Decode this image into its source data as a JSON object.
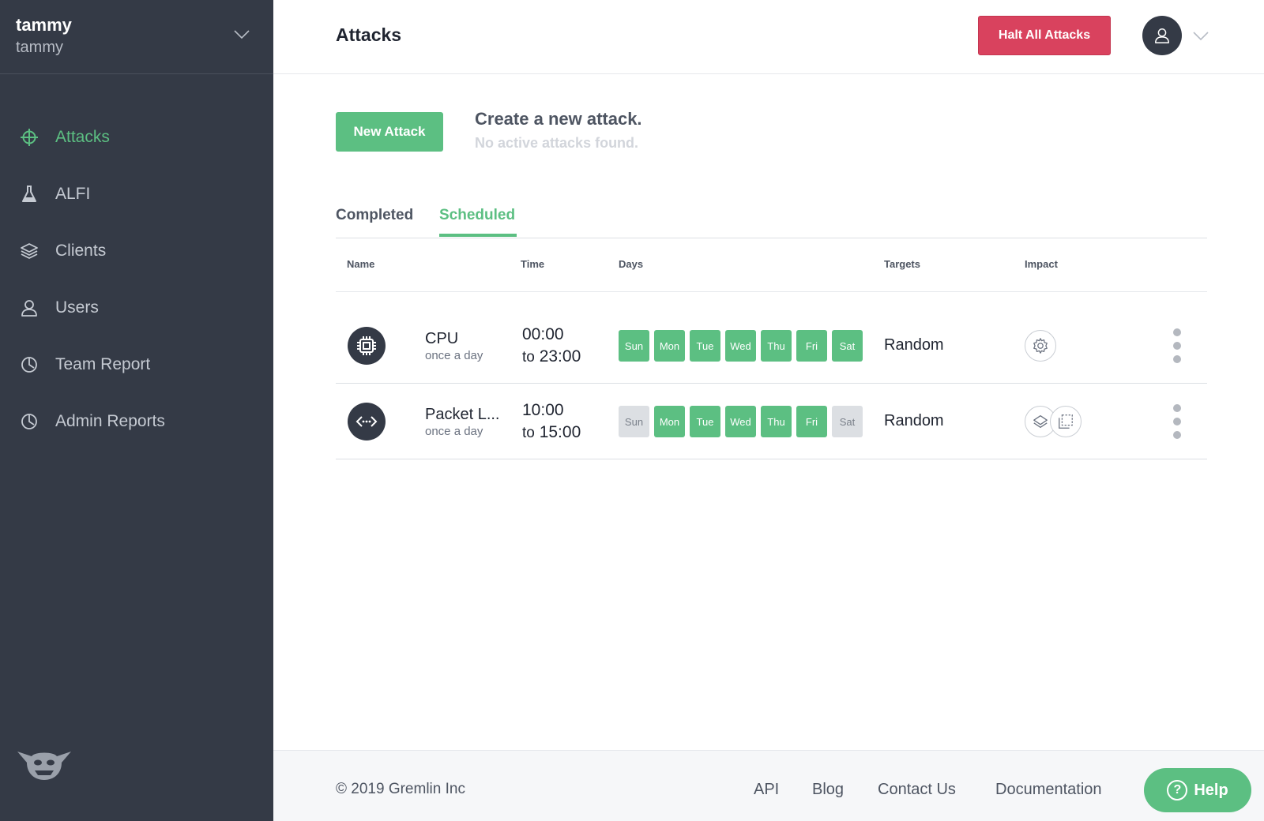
{
  "sidebar": {
    "user_name": "tammy",
    "org_name": "tammy",
    "items": [
      {
        "label": "Attacks",
        "icon": "crosshair-icon",
        "active": true
      },
      {
        "label": "ALFI",
        "icon": "flask-icon",
        "active": false
      },
      {
        "label": "Clients",
        "icon": "layers-icon",
        "active": false
      },
      {
        "label": "Users",
        "icon": "users-icon",
        "active": false
      },
      {
        "label": "Team Report",
        "icon": "pie-chart-icon",
        "active": false
      },
      {
        "label": "Admin Reports",
        "icon": "pie-chart-icon",
        "active": false
      }
    ],
    "logo_icon": "gremlin-logo-icon"
  },
  "header": {
    "title": "Attacks",
    "halt_label": "Halt All Attacks"
  },
  "cta": {
    "button_label": "New Attack",
    "title": "Create a new attack.",
    "subtitle": "No active attacks found."
  },
  "tabs": [
    {
      "label": "Completed",
      "active": false
    },
    {
      "label": "Scheduled",
      "active": true
    }
  ],
  "table": {
    "headers": [
      "Name",
      "Time",
      "Days",
      "Targets",
      "Impact"
    ],
    "rows": [
      {
        "name": "CPU",
        "frequency": "once a day",
        "time_from": "00:00",
        "to_word": "to",
        "time_to": "23:00",
        "days": [
          {
            "label": "Sun",
            "on": true
          },
          {
            "label": "Mon",
            "on": true
          },
          {
            "label": "Tue",
            "on": true
          },
          {
            "label": "Wed",
            "on": true
          },
          {
            "label": "Thu",
            "on": true
          },
          {
            "label": "Fri",
            "on": true
          },
          {
            "label": "Sat",
            "on": true
          }
        ],
        "target": "Random",
        "icon": "cpu-chip-icon",
        "impact_icons": [
          "gear-icon"
        ]
      },
      {
        "name": "Packet L...",
        "frequency": "once a day",
        "time_from": "10:00",
        "to_word": "to",
        "time_to": "15:00",
        "days": [
          {
            "label": "Sun",
            "on": false
          },
          {
            "label": "Mon",
            "on": true
          },
          {
            "label": "Tue",
            "on": true
          },
          {
            "label": "Wed",
            "on": true
          },
          {
            "label": "Thu",
            "on": true
          },
          {
            "label": "Fri",
            "on": true
          },
          {
            "label": "Sat",
            "on": false
          }
        ],
        "target": "Random",
        "icon": "network-arrows-icon",
        "impact_icons": [
          "layers-icon",
          "container-icon"
        ]
      }
    ]
  },
  "footer": {
    "copyright": "© 2019 Gremlin Inc",
    "links": [
      "API",
      "Blog",
      "Contact Us",
      "Documentation"
    ],
    "help_label": "Help"
  },
  "colors": {
    "sidebar_bg": "#343a46",
    "accent_green": "#5cbf82",
    "danger_red": "#d9425e",
    "day_off": "#dcdfe3"
  }
}
